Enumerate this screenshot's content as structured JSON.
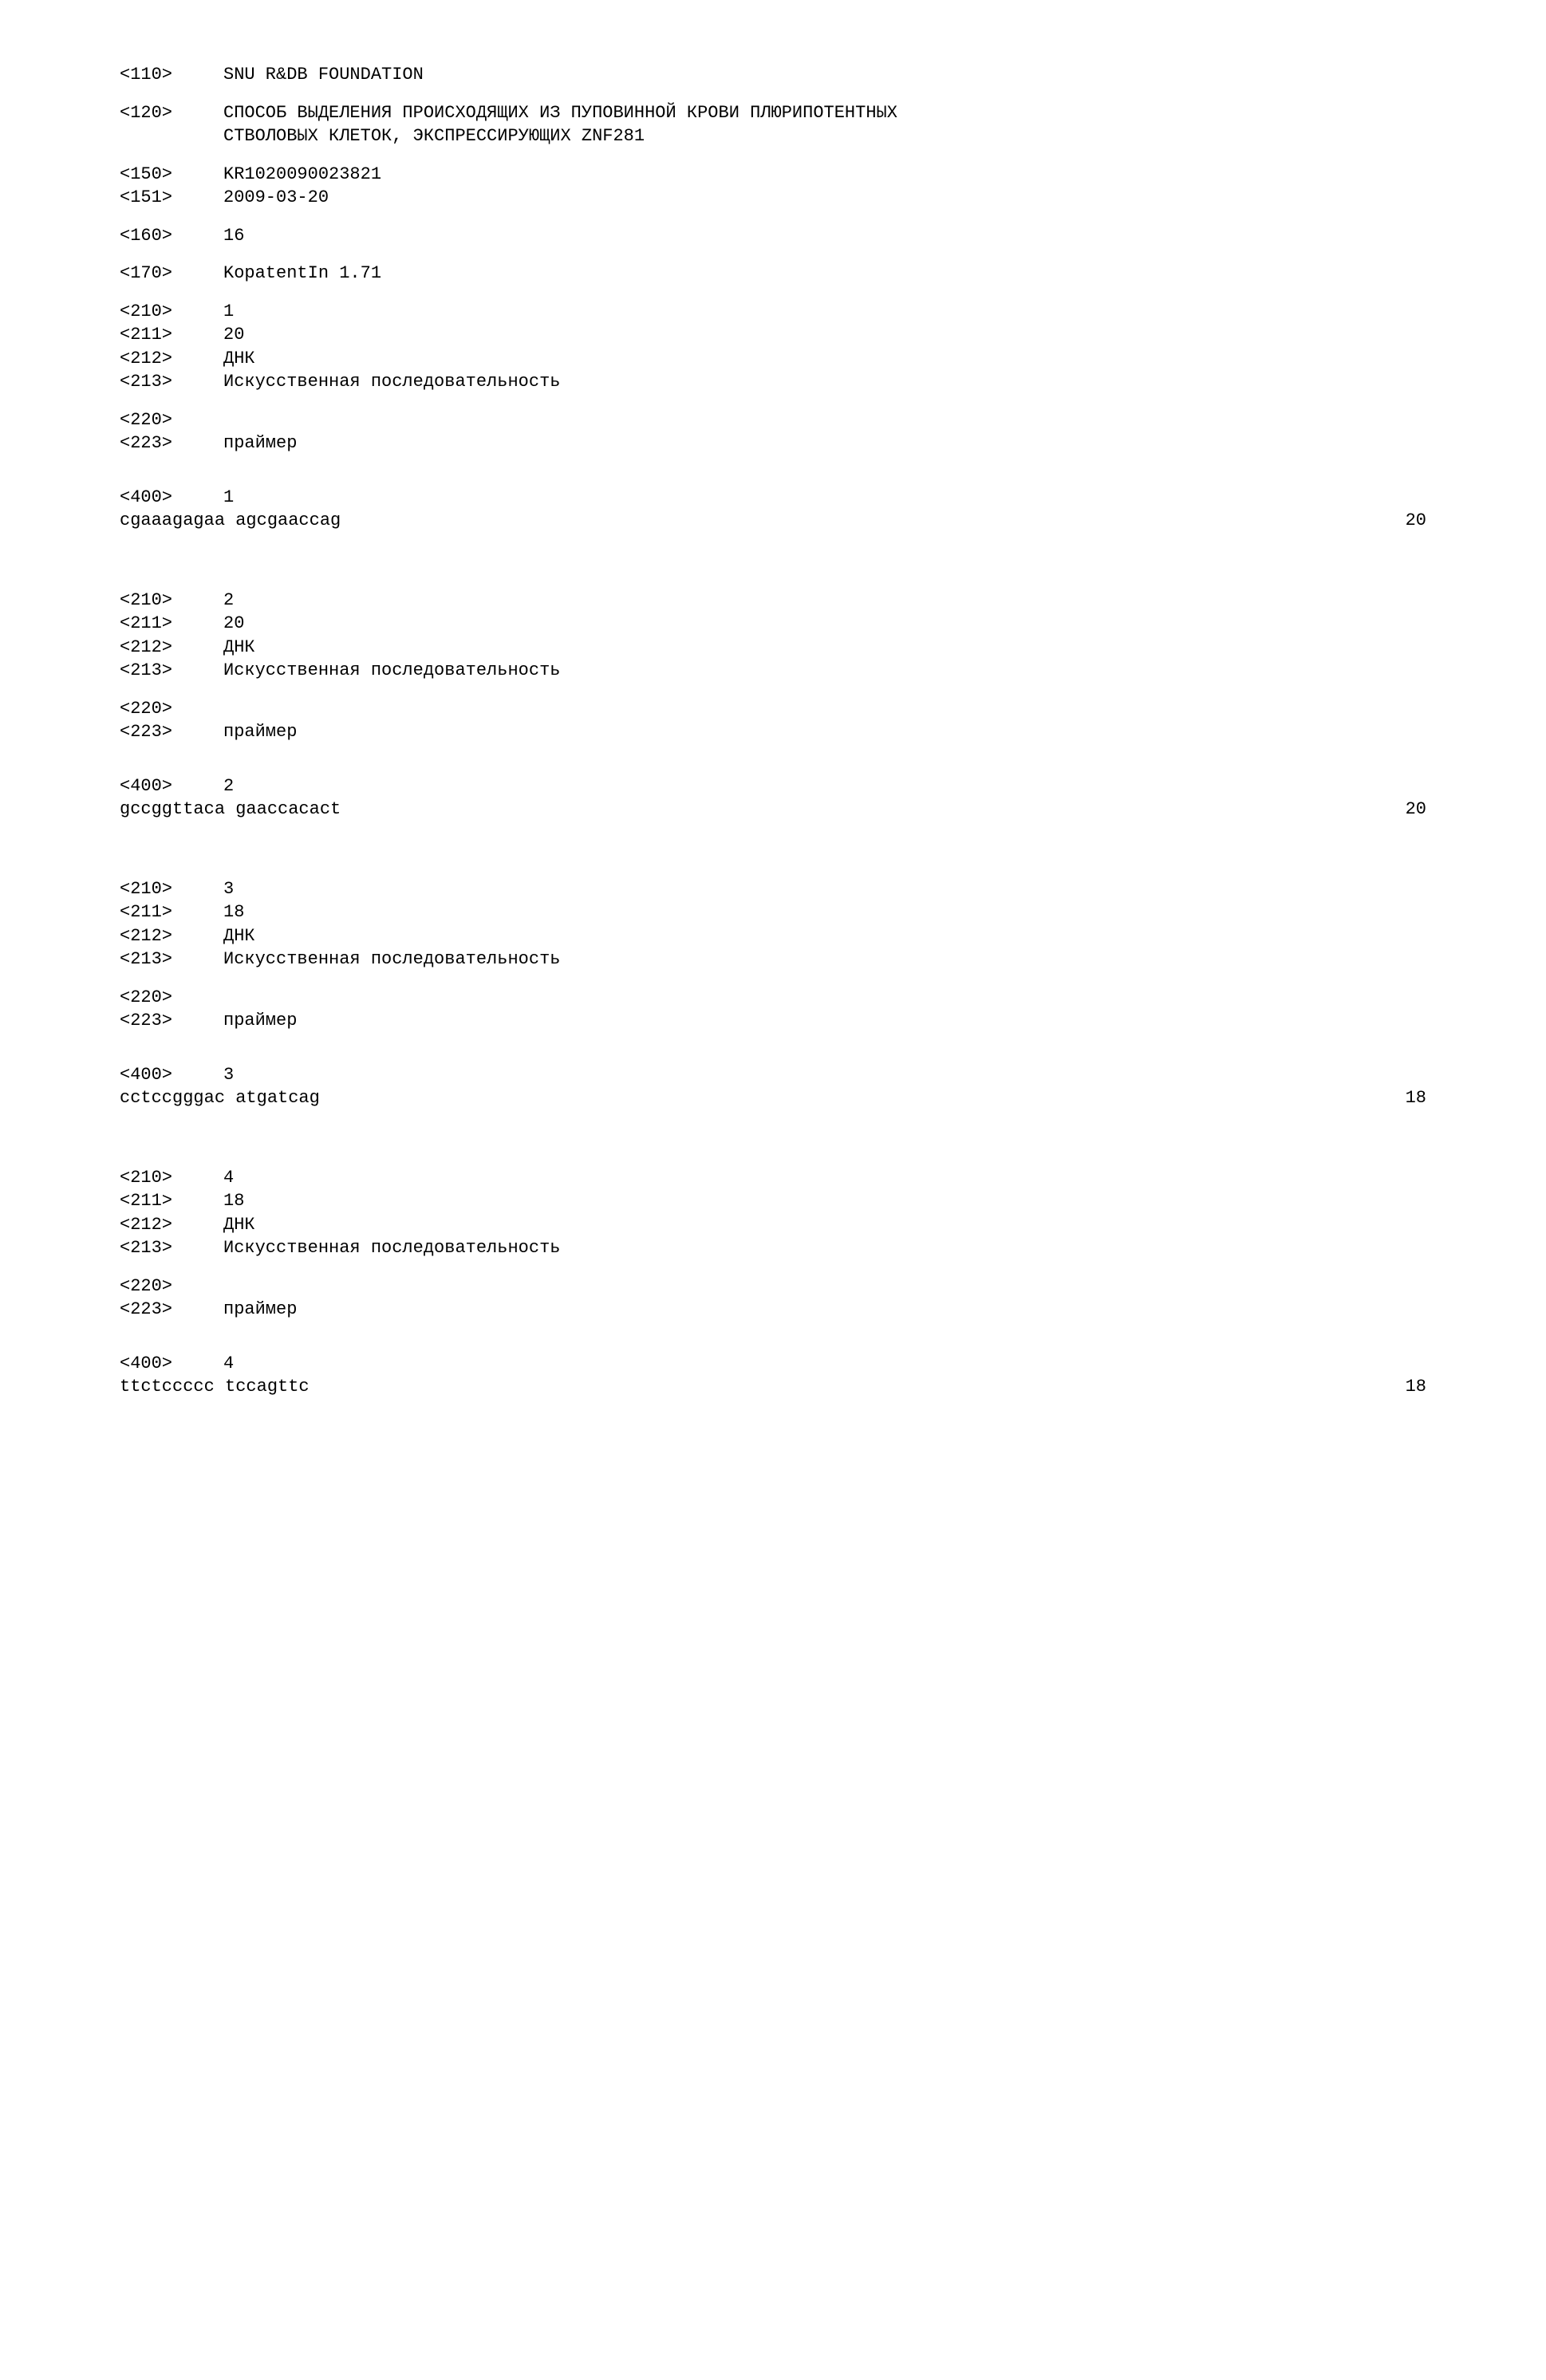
{
  "header": {
    "tag110": "<110>",
    "val110": "SNU R&DB FOUNDATION",
    "tag120": "<120>",
    "val120_line1": "СПОСОБ ВЫДЕЛЕНИЯ ПРОИСХОДЯЩИХ ИЗ ПУПОВИННОЙ КРОВИ ПЛЮРИПОТЕНТНЫХ",
    "val120_line2": "СТВОЛОВЫХ КЛЕТОК, ЭКСПРЕССИРУЮЩИХ ZNF281",
    "tag150": "<150>",
    "val150": "KR1020090023821",
    "tag151": "<151>",
    "val151": "2009-03-20",
    "tag160": "<160>",
    "val160": "16",
    "tag170": "<170>",
    "val170": "KopatentIn 1.71"
  },
  "seq1": {
    "tag210": "<210>",
    "val210": "1",
    "tag211": "<211>",
    "val211": "20",
    "tag212": "<212>",
    "val212": "ДНК",
    "tag213": "<213>",
    "val213": "Искусственная последовательность",
    "tag220": "<220>",
    "tag223": "<223>",
    "val223": "праймер",
    "tag400": "<400>",
    "val400": "1",
    "sequence": "cgaaagagaa agcgaaccag",
    "length": "20"
  },
  "seq2": {
    "tag210": "<210>",
    "val210": "2",
    "tag211": "<211>",
    "val211": "20",
    "tag212": "<212>",
    "val212": "ДНК",
    "tag213": "<213>",
    "val213": "Искусственная последовательность",
    "tag220": "<220>",
    "tag223": "<223>",
    "val223": "праймер",
    "tag400": "<400>",
    "val400": "2",
    "sequence": "gccggttaca gaaccacact",
    "length": "20"
  },
  "seq3": {
    "tag210": "<210>",
    "val210": "3",
    "tag211": "<211>",
    "val211": "18",
    "tag212": "<212>",
    "val212": "ДНК",
    "tag213": "<213>",
    "val213": "Искусственная последовательность",
    "tag220": "<220>",
    "tag223": "<223>",
    "val223": "праймер",
    "tag400": "<400>",
    "val400": "3",
    "sequence": "cctccgggac atgatcag",
    "length": "18"
  },
  "seq4": {
    "tag210": "<210>",
    "val210": "4",
    "tag211": "<211>",
    "val211": "18",
    "tag212": "<212>",
    "val212": "ДНК",
    "tag213": "<213>",
    "val213": "Искусственная последовательность",
    "tag220": "<220>",
    "tag223": "<223>",
    "val223": "праймер",
    "tag400": "<400>",
    "val400": "4",
    "sequence": "ttctccccc tccagttc",
    "length": "18"
  }
}
